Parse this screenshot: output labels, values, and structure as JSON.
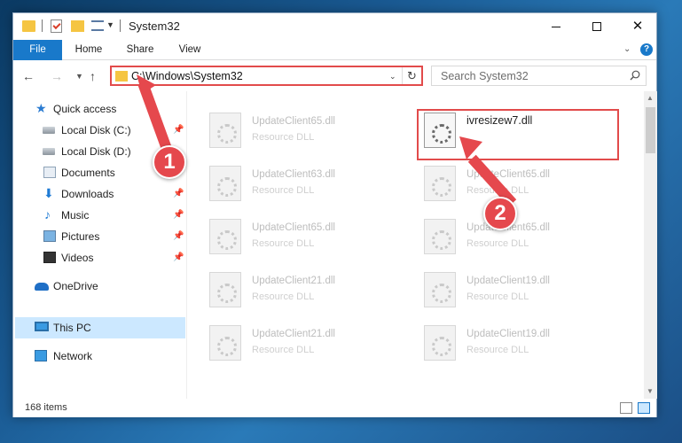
{
  "window": {
    "title": "System32"
  },
  "ribbon": {
    "tabs": [
      "File",
      "Home",
      "Share",
      "View"
    ]
  },
  "navbar": {
    "address": "C:\\Windows\\System32",
    "search_placeholder": "Search System32"
  },
  "sidebar": {
    "items": [
      {
        "label": "Quick access",
        "icon": "star-icon",
        "pinned": false
      },
      {
        "label": "Local Disk (C:)",
        "icon": "disk-icon",
        "pinned": true
      },
      {
        "label": "Local Disk (D:)",
        "icon": "disk-icon",
        "pinned": false
      },
      {
        "label": "Documents",
        "icon": "documents-icon",
        "pinned": false
      },
      {
        "label": "Downloads",
        "icon": "download-icon",
        "pinned": true
      },
      {
        "label": "Music",
        "icon": "music-icon",
        "pinned": true
      },
      {
        "label": "Pictures",
        "icon": "pictures-icon",
        "pinned": true
      },
      {
        "label": "Videos",
        "icon": "videos-icon",
        "pinned": true
      },
      {
        "label": "OneDrive",
        "icon": "onedrive-icon",
        "pinned": false
      },
      {
        "label": "This PC",
        "icon": "pc-icon",
        "pinned": false,
        "selected": true
      },
      {
        "label": "Network",
        "icon": "network-icon",
        "pinned": false
      }
    ]
  },
  "files": [
    {
      "name": "UpdateClient65.dll",
      "type": "Resource DLL"
    },
    {
      "name": "ivresizew7.dll",
      "type": "",
      "highlighted": true
    },
    {
      "name": "UpdateClient63.dll",
      "type": "Resource DLL"
    },
    {
      "name": "UpdateClient65.dll",
      "type": "Resource DLL"
    },
    {
      "name": "UpdateClient65.dll",
      "type": "Resource DLL"
    },
    {
      "name": "UpdateClient65.dll",
      "type": "Resource DLL"
    },
    {
      "name": "UpdateClient21.dll",
      "type": "Resource DLL"
    },
    {
      "name": "UpdateClient19.dll",
      "type": "Resource DLL"
    },
    {
      "name": "UpdateClient21.dll",
      "type": "Resource DLL"
    },
    {
      "name": "UpdateClient19.dll",
      "type": "Resource DLL"
    }
  ],
  "status": {
    "item_count": "168 items"
  },
  "annotations": {
    "step1": "1",
    "step2": "2",
    "color": "#e5484d"
  }
}
